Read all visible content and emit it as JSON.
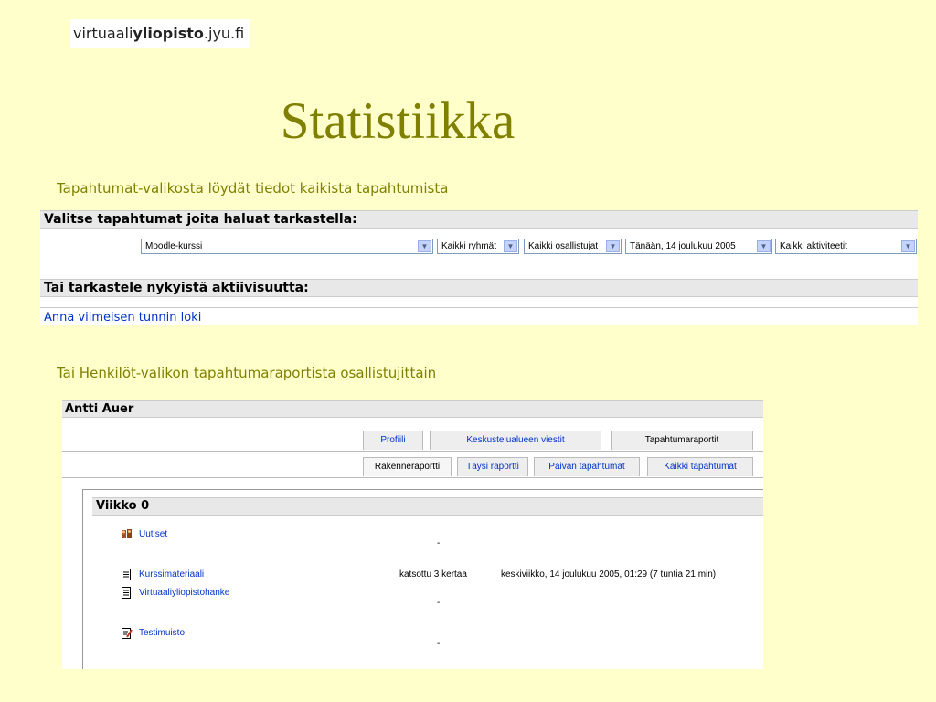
{
  "logo": {
    "prefix": "virtuaali",
    "bold": "yliopisto",
    "suffix": ".jyu.fi"
  },
  "title": "Statistiikka",
  "caption1": "Tapahtumat-valikosta löydät tiedot kaikista tapahtumista",
  "caption2": "Tai Henkilöt-valikon tapahtumaraportista osallistujittain",
  "events_panel": {
    "heading": "Valitse tapahtumat joita haluat tarkastella:",
    "selects": {
      "course": "Moodle-kurssi",
      "groups": "Kaikki ryhmät",
      "participants": "Kaikki osallistujat",
      "date": "Tänään, 14 joulukuu 2005",
      "activities": "Kaikki aktiviteetit"
    },
    "activity_heading": "Tai tarkastele nykyistä aktiivisuutta:",
    "log_link": "Anna viimeisen tunnin loki"
  },
  "user_panel": {
    "name": "Antti Auer",
    "tabs_top": [
      "Profiili",
      "Keskustelualueen viestit",
      "Tapahtumaraportit"
    ],
    "tabs_bottom": [
      "Rakenneraportti",
      "Täysi raportti",
      "Päivän tapahtumat",
      "Kaikki tapahtumat"
    ],
    "week_title": "Viikko 0",
    "items": [
      {
        "name": "Uutiset",
        "icon": "forum-icon",
        "views": "",
        "time": "",
        "dash": "-"
      },
      {
        "name": "Kurssimateriaali",
        "icon": "document-icon",
        "views": "katsottu 3 kertaa",
        "time": "keskiviikko, 14 joulukuu 2005, 01:29 (7 tuntia 21 min)",
        "dash": ""
      },
      {
        "name": "Virtuaaliyliopistohanke",
        "icon": "document-icon",
        "views": "",
        "time": "",
        "dash": "-"
      },
      {
        "name": "Testimuisto",
        "icon": "edit-document-icon",
        "views": "",
        "time": "",
        "dash": "-"
      }
    ]
  },
  "colors": {
    "background": "#ffffcc",
    "title": "#808000",
    "link": "#0033cc"
  }
}
